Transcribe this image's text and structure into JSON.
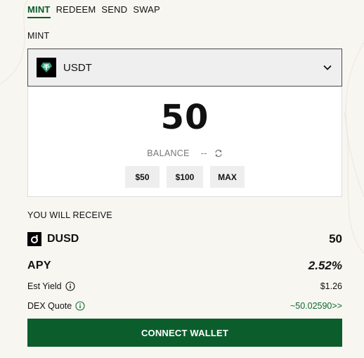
{
  "tabs": [
    {
      "label": "MINT",
      "active": true
    },
    {
      "label": "REDEEM",
      "active": false
    },
    {
      "label": "SEND",
      "active": false
    },
    {
      "label": "SWAP",
      "active": false
    }
  ],
  "mint_label": "MINT",
  "token": {
    "name": "USDT",
    "icon": "tether-icon",
    "icon_color": "#26a17b"
  },
  "amount": "50",
  "balance": {
    "label": "BALANCE",
    "value": "--"
  },
  "quick_amounts": [
    "$50",
    "$100",
    "MAX"
  ],
  "receive": {
    "label": "YOU WILL RECEIVE",
    "token_name": "DUSD",
    "token_icon": "dusd-icon",
    "amount": "50"
  },
  "apy": {
    "label": "APY",
    "value": "2.52%"
  },
  "est_yield": {
    "label": "Est Yield",
    "value": "$1.26"
  },
  "dex_quote": {
    "label": "DEX Quote",
    "value": "~50.02590>>"
  },
  "connect_button": "CONNECT WALLET",
  "colors": {
    "accent": "#0b5e2c",
    "background": "#f8f6f1"
  }
}
